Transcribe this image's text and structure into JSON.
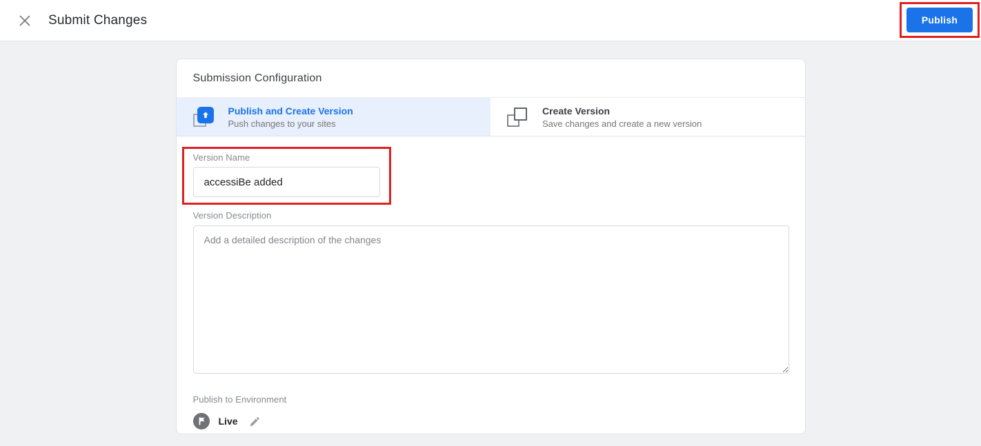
{
  "header": {
    "title": "Submit Changes",
    "publish_label": "Publish"
  },
  "card": {
    "title": "Submission Configuration",
    "tabs": [
      {
        "label": "Publish and Create Version",
        "description": "Push changes to your sites",
        "icon": "publish-upload-pages-icon",
        "selected": true
      },
      {
        "label": "Create Version",
        "description": "Save changes and create a new version",
        "icon": "copy-pages-icon",
        "selected": false
      }
    ],
    "version_name": {
      "label": "Version Name",
      "value": "accessiBe added"
    },
    "version_description": {
      "label": "Version Description",
      "placeholder": "Add a detailed description of the changes"
    },
    "publish_environment": {
      "label": "Publish to Environment",
      "value": "Live",
      "icon": "live-environment-flag-icon",
      "edit_icon": "pencil-edit-icon"
    }
  },
  "icons": {
    "close": "close-x-icon"
  },
  "colors": {
    "accent_blue": "#1a73e8",
    "selected_tab_bg": "#e8effd",
    "annotation_red": "#e02020",
    "page_bg": "#f0f1f2"
  },
  "annotations": [
    "publish-button-highlight",
    "version-name-field-highlight"
  ]
}
